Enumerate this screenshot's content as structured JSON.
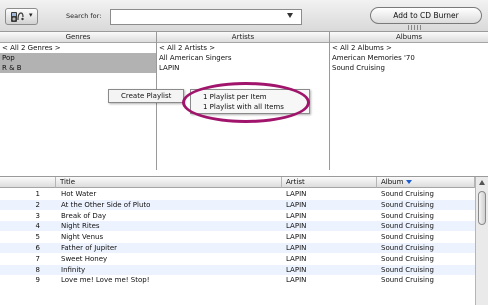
{
  "toolbar": {
    "library_icon": "ipod-headphones-icon",
    "search_label": "Search for:",
    "search_value": "",
    "burn_button": "Add to CD Burner"
  },
  "browser": {
    "genres": {
      "header": "Genres",
      "items": [
        "< All 2 Genres >",
        "Pop",
        "R & B"
      ]
    },
    "artists": {
      "header": "Artists",
      "items": [
        "< All 2 Artists >",
        "All American Singers",
        "LAPIN"
      ]
    },
    "albums": {
      "header": "Albums",
      "items": [
        "< All 2 Albums >",
        "American Memories '70",
        "Sound Cruising"
      ]
    }
  },
  "context_menu": {
    "item": "Create Playlist",
    "submenu": [
      "1 Playlist per Item",
      "1 Playlist with all Items"
    ],
    "highlight_color": "#a0146c"
  },
  "tracks": {
    "columns": {
      "title": "Title",
      "artist": "Artist",
      "album": "Album"
    },
    "sort_color": "#1a5fd0",
    "rows": [
      {
        "num": "1",
        "title": "Hot Water",
        "artist": "LAPIN",
        "album": "Sound Cruising"
      },
      {
        "num": "2",
        "title": "At the Other Side of Pluto",
        "artist": "LAPIN",
        "album": "Sound Cruising"
      },
      {
        "num": "3",
        "title": "Break of Day",
        "artist": "LAPIN",
        "album": "Sound Cruising"
      },
      {
        "num": "4",
        "title": "Night Rites",
        "artist": "LAPIN",
        "album": "Sound Cruising"
      },
      {
        "num": "5",
        "title": "Night Venus",
        "artist": "LAPIN",
        "album": "Sound Cruising"
      },
      {
        "num": "6",
        "title": "Father of Jupiter",
        "artist": "LAPIN",
        "album": "Sound Cruising"
      },
      {
        "num": "7",
        "title": "Sweet Honey",
        "artist": "LAPIN",
        "album": "Sound Cruising"
      },
      {
        "num": "8",
        "title": "Infinity",
        "artist": "LAPIN",
        "album": "Sound Cruising"
      },
      {
        "num": "9",
        "title": "Love me! Love me! Stop!",
        "artist": "LAPIN",
        "album": "Sound Cruising"
      }
    ]
  }
}
